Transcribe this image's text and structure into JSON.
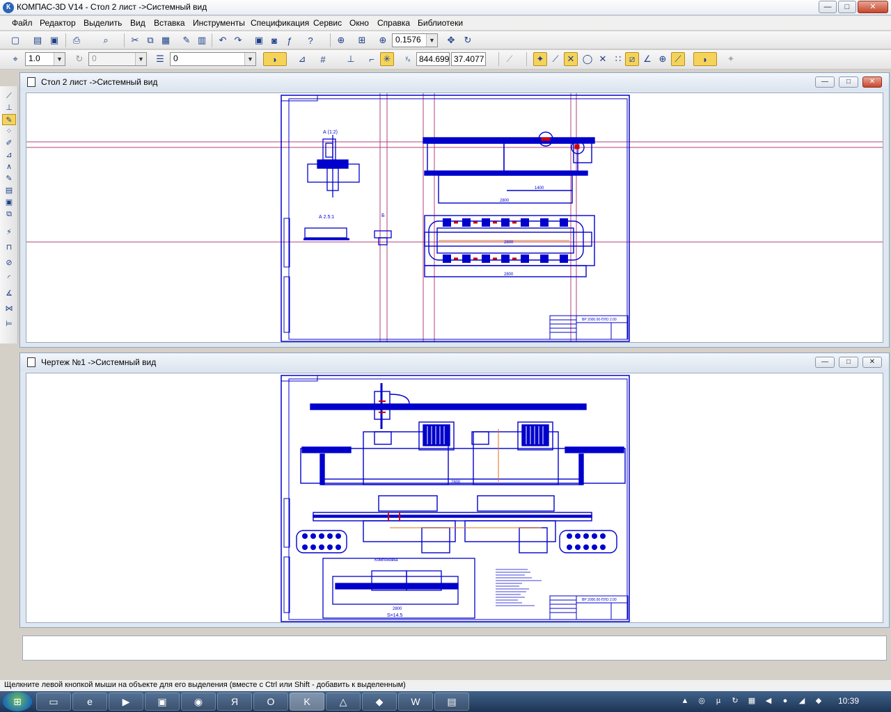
{
  "window": {
    "title": "КОМПАС-3D V14 - Стол 2 лист ->Системный вид",
    "app_icon": "К",
    "controls": {
      "minimize": "—",
      "maximize": "□",
      "close": "✕"
    }
  },
  "menu": [
    "Файл",
    "Редактор",
    "Выделить",
    "Вид",
    "Вставка",
    "Инструменты",
    "Спецификация",
    "Сервис",
    "Окно",
    "Справка",
    "Библиотеки"
  ],
  "toolbar1": {
    "zoom_value": "0.1576"
  },
  "toolbar2": {
    "step_value": "1.0",
    "angle_value": "0",
    "layer_value": "0",
    "coord_x": "844.699",
    "coord_y": "37.4077"
  },
  "doc_windows": [
    {
      "title": "Стол 2 лист ->Системный вид",
      "controls": {
        "minimize": "—",
        "maximize": "□",
        "close": "✕"
      }
    },
    {
      "title": "Чертеж №1 ->Системный вид",
      "controls": {
        "minimize": "—",
        "maximize": "□",
        "close": "✕"
      }
    }
  ],
  "drawing_top": {
    "stamp": "ВР 2000.00-ПЛО 2.00",
    "view_a_label": "А (1:2)",
    "view_b_label": "Б",
    "section_label": "А 2.5:1",
    "dims": [
      "1400",
      "2800",
      "2800",
      "2800"
    ]
  },
  "drawing_bottom": {
    "stamp": "ВР 2000.00-ПЛО 2.00",
    "detail_label": "Компоновка",
    "scale_label": "S=14.5",
    "dims": [
      "2800",
      "2800"
    ]
  },
  "status_text": "Щелкните левой кнопкой мыши на объекте для его выделения (вместе с Ctrl или Shift - добавить к выделенным)",
  "taskbar": {
    "start_icon": "⊞",
    "apps": [
      "folder-icon",
      "ie-icon",
      "media-icon",
      "save-icon",
      "chrome-icon",
      "yandex-icon",
      "opera-icon",
      "kompas-icon",
      "avast-icon",
      "app-icon",
      "word-icon",
      "note-icon"
    ],
    "clock": "10:39"
  },
  "colors": {
    "drawing_blue": "#0000cc",
    "guide_magenta": "#b0407a",
    "highlight_red": "#d00000",
    "accent_orange": "#e07010",
    "active_button": "#f5d35b"
  }
}
